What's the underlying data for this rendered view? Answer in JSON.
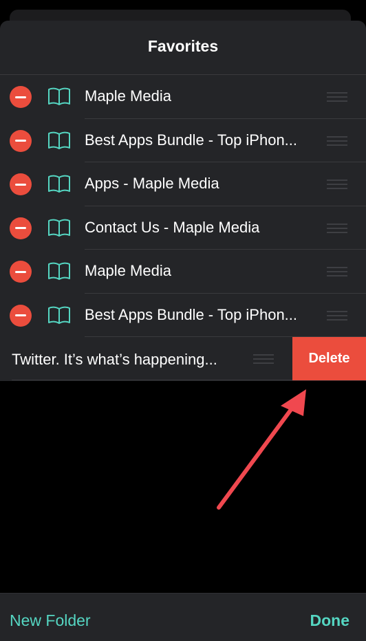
{
  "header": {
    "title": "Favorites"
  },
  "bookmarks": [
    {
      "label": "Maple Media"
    },
    {
      "label": "Best Apps Bundle - Top iPhon..."
    },
    {
      "label": "Apps - Maple Media"
    },
    {
      "label": "Contact Us - Maple Media"
    },
    {
      "label": "Maple Media"
    },
    {
      "label": "Best Apps Bundle - Top iPhon..."
    }
  ],
  "swiped_item": {
    "label": "Twitter. It’s what’s happening...",
    "delete_label": "Delete"
  },
  "toolbar": {
    "new_folder_label": "New Folder",
    "done_label": "Done"
  },
  "icons": {
    "remove": "minus-circle-icon",
    "bookmark": "book-icon",
    "reorder": "reorder-handle-icon",
    "annotation": "arrow-annotation-icon"
  },
  "colors": {
    "accent": "#55d6c2",
    "destructive": "#eb4d3d",
    "sheet_background": "#242528",
    "screen_background": "#000000",
    "annotation_arrow": "#f0484f"
  }
}
